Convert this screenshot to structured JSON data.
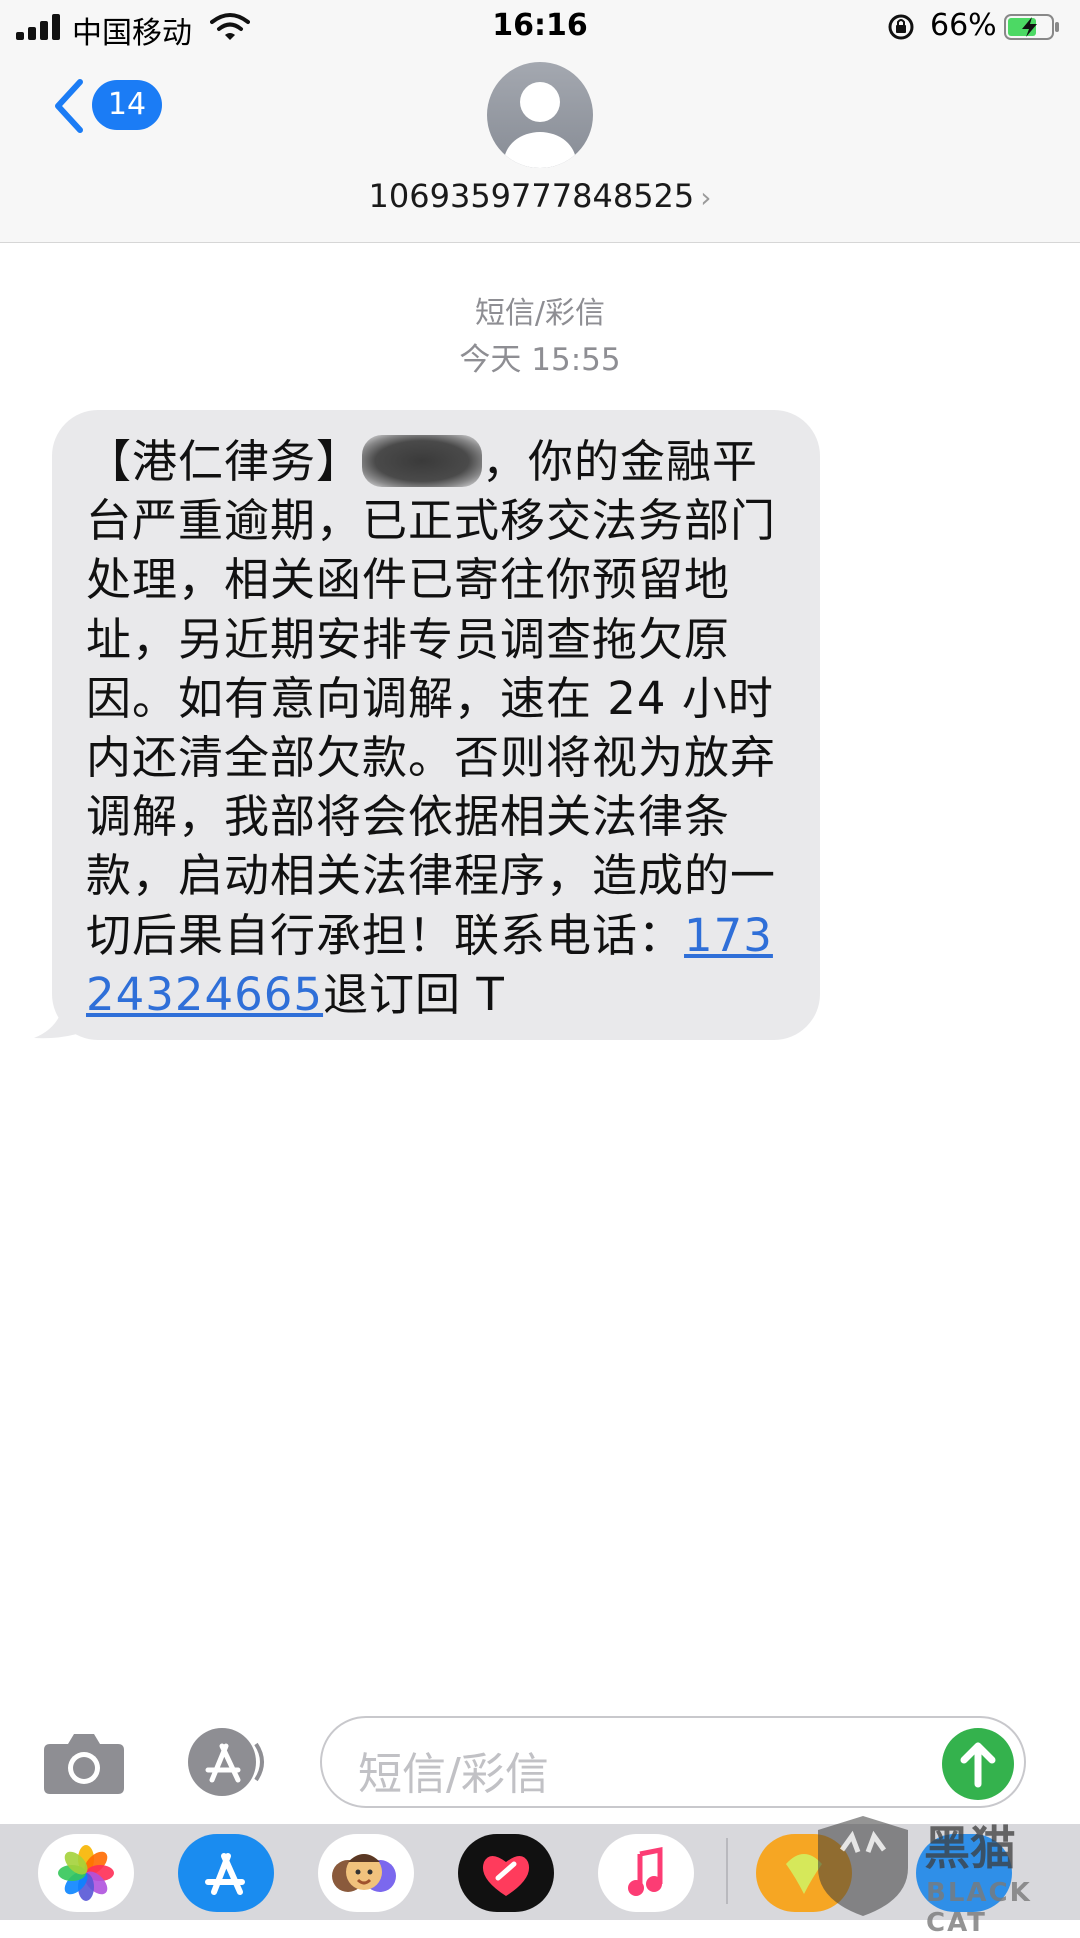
{
  "status_bar": {
    "carrier": "中国移动",
    "time": "16:16",
    "battery_percent": "66%",
    "battery_level": 0.66,
    "icons": [
      "signal-icon",
      "wifi-icon",
      "orientation-lock-icon",
      "battery-charging-icon"
    ]
  },
  "header": {
    "back_badge": "14",
    "contact_number": "1069359777848525",
    "contact_chevron": "›",
    "icons": [
      "chevron-left-icon",
      "avatar-person-icon"
    ]
  },
  "conversation": {
    "message_kind": "短信/彩信",
    "timestamp": "今天 15:55",
    "message": {
      "prefix": "【港仁律务】",
      "body": "，你的金融平台严重逾期，已正式移交法务部门处理，相关函件已寄往你预留地址，另近期安排专员调查拖欠原因。如有意向调解，速在 24 小时内还清全部欠款。否则将视为放弃调解，我部将会依据相关法律条款，启动相关法律程序，造成的一切后果自行承担！联系电话：",
      "phone": "17324324665",
      "suffix": "退订回 T"
    }
  },
  "input_bar": {
    "placeholder": "短信/彩信",
    "icons": [
      "camera-icon",
      "app-store-icon",
      "send-arrow-icon"
    ]
  },
  "app_drawer": {
    "apps": [
      "photos-app-icon",
      "app-store-app-icon",
      "memoji-app-icon",
      "digital-touch-app-icon",
      "music-app-icon",
      "yellow-app-icon",
      "blue-app-icon"
    ]
  },
  "watermark": {
    "brand": "黑猫",
    "brand_en": "BLACK CAT"
  },
  "colors": {
    "accent_blue": "#1b7cf5",
    "send_green": "#34b24d",
    "bubble_gray": "#e9e9eb",
    "link_blue": "#2f6fd8"
  }
}
